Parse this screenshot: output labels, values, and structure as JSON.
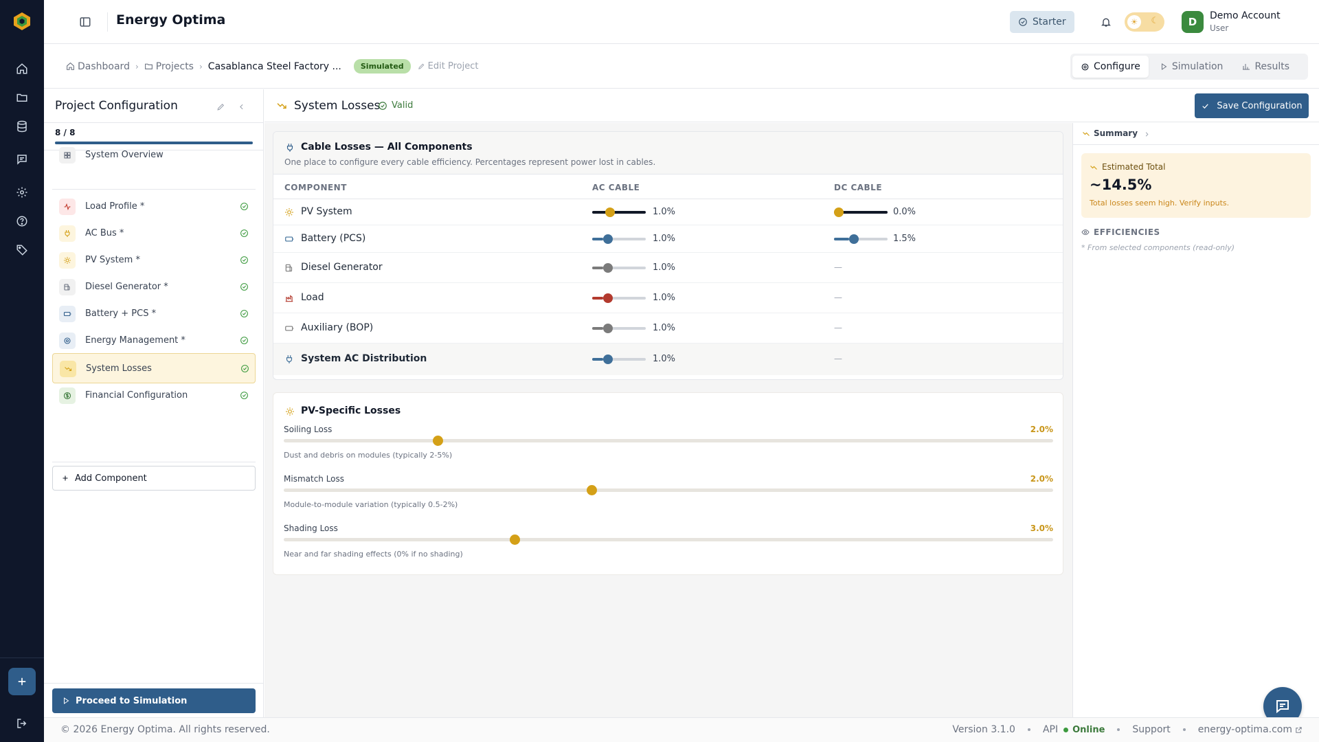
{
  "app": {
    "title": "Energy Optima"
  },
  "header": {
    "plan_label": "Starter",
    "account_initial": "D",
    "account_name": "Demo Account",
    "account_role": "User"
  },
  "breadcrumb": {
    "items": [
      "Dashboard",
      "Projects",
      "Casablanca Steel Factory ..."
    ],
    "status_badge": "Simulated",
    "edit_label": "Edit Project"
  },
  "view_tabs": [
    {
      "label": "Configure",
      "icon": "gear-icon",
      "active": true
    },
    {
      "label": "Simulation",
      "icon": "play-icon",
      "active": false
    },
    {
      "label": "Results",
      "icon": "bar-chart-icon",
      "active": false
    }
  ],
  "sidebar": {
    "title": "Project Configuration",
    "progress_label": "8 / 8",
    "progress_fraction": 1.0,
    "steps": [
      {
        "label": "System Overview",
        "icon": "grid-icon",
        "completed": false,
        "active": false,
        "icon_color": "#6b7280",
        "icon_bg": "#f1f1f1"
      },
      {
        "label": "Load Profile *",
        "icon": "pulse-icon",
        "completed": true,
        "active": false,
        "icon_color": "#c0392b",
        "icon_bg": "#fde7e7"
      },
      {
        "label": "AC Bus *",
        "icon": "plug-icon",
        "completed": true,
        "active": false,
        "icon_color": "#d4a017",
        "icon_bg": "#fdf5de"
      },
      {
        "label": "PV System *",
        "icon": "sun-icon",
        "completed": true,
        "active": false,
        "icon_color": "#d4a017",
        "icon_bg": "#fdf5de"
      },
      {
        "label": "Diesel Generator *",
        "icon": "fuel-icon",
        "completed": true,
        "active": false,
        "icon_color": "#6b7280",
        "icon_bg": "#f1f1f1"
      },
      {
        "label": "Battery + PCS *",
        "icon": "battery-icon",
        "completed": true,
        "active": false,
        "icon_color": "#2f5d8a",
        "icon_bg": "#e8eef5"
      },
      {
        "label": "Energy Management *",
        "icon": "cpu-icon",
        "completed": true,
        "active": false,
        "icon_color": "#2f5d8a",
        "icon_bg": "#e8eef5"
      },
      {
        "label": "System Losses",
        "icon": "trending-down-icon",
        "completed": true,
        "active": true,
        "icon_color": "#d4a017",
        "icon_bg": "#f9e6a6"
      },
      {
        "label": "Financial Configuration",
        "icon": "dollar-icon",
        "completed": true,
        "active": false,
        "icon_color": "#3c7a3c",
        "icon_bg": "#e6f2e2"
      }
    ],
    "add_component_label": "Add Component",
    "proceed_label": "Proceed to Simulation"
  },
  "content_header": {
    "title": "System Losses",
    "valid_label": "Valid",
    "save_label": "Save Configuration"
  },
  "cable_losses": {
    "title": "Cable Losses — All Components",
    "subtitle": "One place to configure every cable efficiency. Percentages represent power lost in cables.",
    "columns": [
      "COMPONENT",
      "AC CABLE",
      "DC CABLE"
    ],
    "rows": [
      {
        "label": "PV System",
        "icon": "sun-icon",
        "color": "#d4a017",
        "ac_value": "1.0%",
        "ac_fraction": 0.3,
        "dc_value": "0.0%",
        "dc_fraction": 0.0,
        "dc_na": ""
      },
      {
        "label": "Battery (PCS)",
        "icon": "battery-icon",
        "color": "#3f6f99",
        "ac_value": "1.0%",
        "ac_fraction": 0.25,
        "dc_value": "1.5%",
        "dc_fraction": 0.35,
        "dc_na": ""
      },
      {
        "label": "Diesel Generator",
        "icon": "fuel-icon",
        "color": "#7b7b7b",
        "ac_value": "1.0%",
        "ac_fraction": 0.25,
        "dc_value": "",
        "dc_fraction": null,
        "dc_na": "—"
      },
      {
        "label": "Load",
        "icon": "load-icon",
        "color": "#b33a2e",
        "ac_value": "1.0%",
        "ac_fraction": 0.25,
        "dc_value": "",
        "dc_fraction": null,
        "dc_na": "—"
      },
      {
        "label": "Auxiliary (BOP)",
        "icon": "battery-icon",
        "color": "#7b7b7b",
        "ac_value": "1.0%",
        "ac_fraction": 0.25,
        "dc_value": "",
        "dc_fraction": null,
        "dc_na": "—"
      },
      {
        "label": "System AC Distribution",
        "icon": "plug-icon",
        "color": "#3f6f99",
        "ac_value": "1.0%",
        "ac_fraction": 0.25,
        "dc_value": "",
        "dc_fraction": null,
        "dc_na": "—"
      }
    ]
  },
  "pv_losses": {
    "title": "PV-Specific Losses",
    "items": [
      {
        "label": "Soiling Loss",
        "value": "2.0%",
        "fraction": 0.2,
        "hint": "Dust and debris on modules (typically 2-5%)"
      },
      {
        "label": "Mismatch Loss",
        "value": "2.0%",
        "fraction": 0.4,
        "hint": "Module-to-module variation (typically 0.5-2%)"
      },
      {
        "label": "Shading Loss",
        "value": "3.0%",
        "fraction": 0.3,
        "hint": "Near and far shading effects (0% if no shading)"
      }
    ]
  },
  "summary": {
    "header_label": "Summary",
    "estimated_label": "Estimated Total",
    "estimated_value": "~14.5%",
    "warning": "Total losses seem high. Verify inputs.",
    "efficiencies_label": "EFFICIENCIES",
    "efficiencies_note": "* From selected components (read-only)"
  },
  "footer": {
    "copyright": "© 2026 Energy Optima. All rights reserved.",
    "version": "Version 3.1.0",
    "api_label": "API",
    "api_status": "Online",
    "support": "Support",
    "site": "energy-optima.com"
  }
}
